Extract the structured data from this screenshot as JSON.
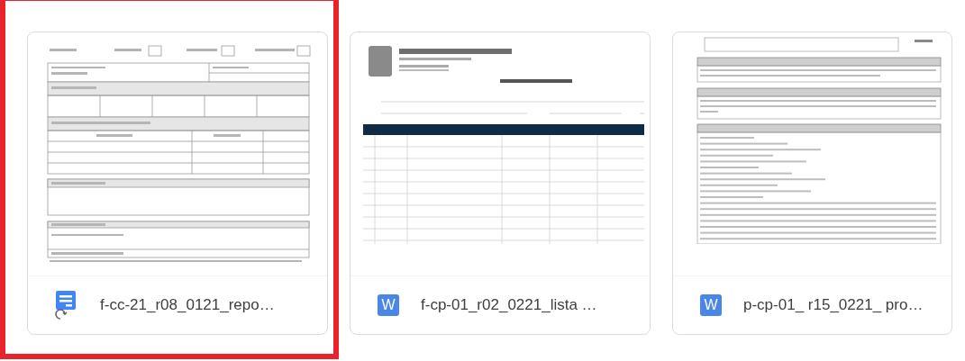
{
  "files": [
    {
      "name": "f-cc-21_r08_0121_repo…",
      "kind": "form",
      "selected": true
    },
    {
      "name": "f-cp-01_r02_0221_lista …",
      "kind": "attendance",
      "icon_text": "W",
      "selected": false
    },
    {
      "name": "p-cp-01_ r15_0221_ pro…",
      "kind": "procedure",
      "icon_text": "W",
      "selected": false
    }
  ]
}
